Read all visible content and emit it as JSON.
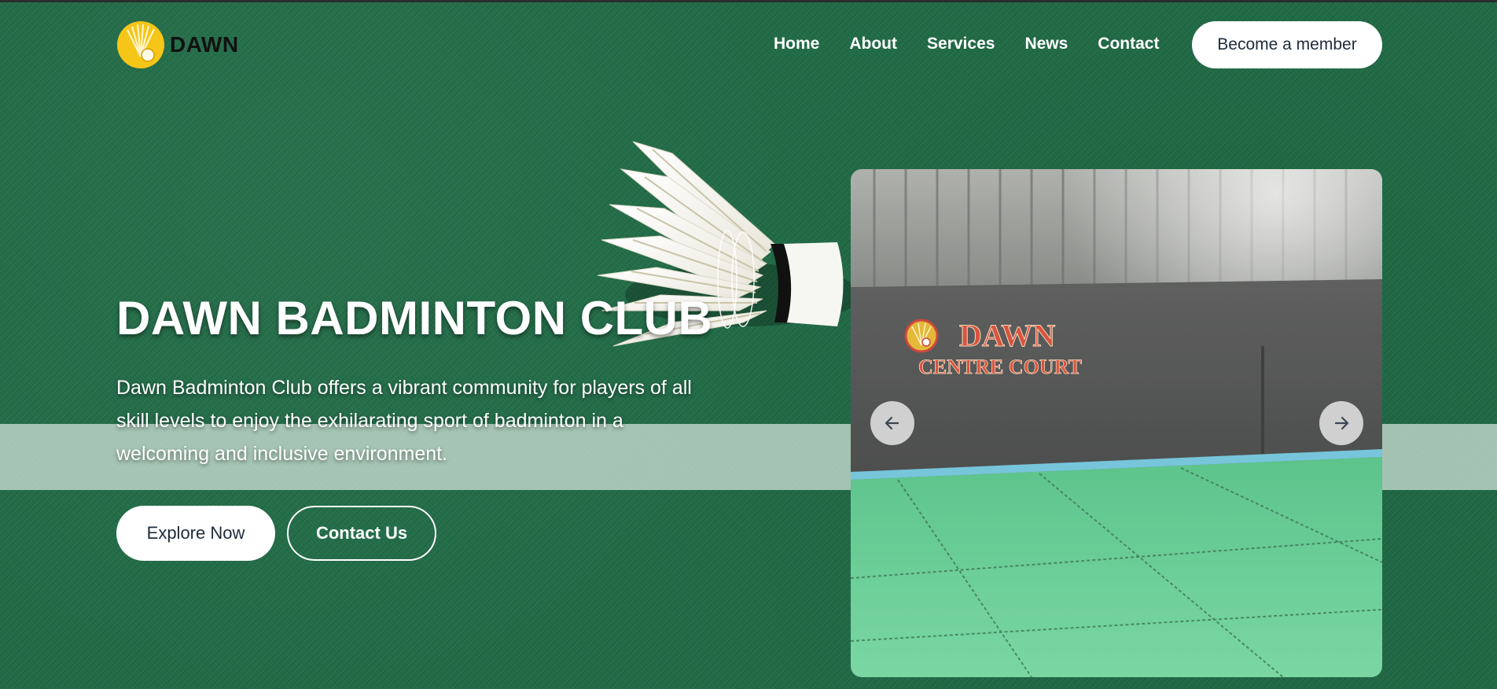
{
  "brand": {
    "name": "DAWN",
    "logo_icon": "shuttlecock-sun-icon",
    "logo_color": "#f5c518"
  },
  "nav": {
    "items": [
      {
        "label": "Home"
      },
      {
        "label": "About"
      },
      {
        "label": "Services"
      },
      {
        "label": "News"
      },
      {
        "label": "Contact"
      }
    ],
    "cta_label": "Become a member"
  },
  "hero": {
    "title": "DAWN BADMINTON CLUB",
    "description": "Dawn Badminton Club offers a vibrant community for players of all skill levels to enjoy the exhilarating sport of badminton in a welcoming and inclusive environment.",
    "primary_button": "Explore Now",
    "secondary_button": "Contact Us"
  },
  "slider": {
    "slide_sign_line1": "DAWN",
    "slide_sign_line2": "CENTRE COURT",
    "prev_icon": "arrow-left-icon",
    "next_icon": "arrow-right-icon"
  },
  "colors": {
    "background_green": "#1f6a45",
    "court_green": "#52c98a",
    "sign_red": "#c8372e",
    "button_text": "#1d2b3a"
  }
}
